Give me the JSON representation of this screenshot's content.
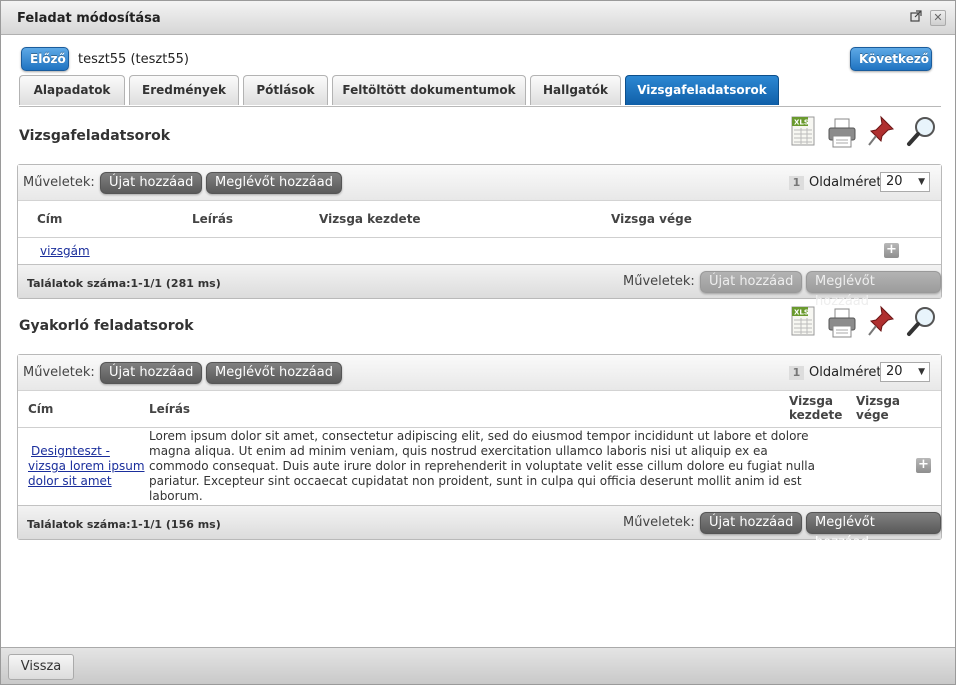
{
  "window": {
    "title": "Feladat módosítása"
  },
  "nav": {
    "prev_label": "Előző",
    "next_label": "Következő",
    "record_name": "teszt55 (teszt55)"
  },
  "tabs": [
    {
      "label": "Alapadatok"
    },
    {
      "label": "Eredmények"
    },
    {
      "label": "Pótlások"
    },
    {
      "label": "Feltöltött dokumentumok"
    },
    {
      "label": "Hallgatók"
    },
    {
      "label": "Vizsgafeladatsorok"
    }
  ],
  "toolbar_icons": [
    "xls-export-icon",
    "print-icon",
    "pin-icon",
    "search-icon"
  ],
  "xls_icon_text": "XLS",
  "section1": {
    "title": "Vizsgafeladatsorok",
    "ops_label": "Műveletek:",
    "add_new": "Újat hozzáad",
    "add_existing": "Meglévőt hozzáad",
    "page_number": "1",
    "page_size_label": "Oldalméret",
    "page_size": "20",
    "columns": {
      "title": "Cím",
      "description": "Leírás",
      "start": "Vizsga kezdete",
      "end": "Vizsga vége"
    },
    "rows": [
      {
        "title": "vizsgám"
      }
    ],
    "result_count": "Találatok száma:1-1/1 (281 ms)"
  },
  "section2": {
    "title": "Gyakorló feladatsorok",
    "ops_label": "Műveletek:",
    "add_new": "Újat hozzáad",
    "add_existing": "Meglévőt hozzáad",
    "page_number": "1",
    "page_size_label": "Oldalméret",
    "page_size": "20",
    "columns": {
      "title": "Cím",
      "description": "Leírás",
      "start_line1": "Vizsga",
      "start_line2": "kezdete",
      "end_line1": "Vizsga",
      "end_line2": "vége"
    },
    "rows": [
      {
        "title_lines": [
          "Designteszt -",
          "vizsga lorem ipsum",
          "dolor sit amet"
        ],
        "description_lines": [
          "Lorem ipsum dolor sit amet, consectetur adipiscing elit, sed do eiusmod tempor incididunt ut labore et dolore",
          "magna aliqua. Ut enim ad minim veniam, quis nostrud exercitation ullamco laboris nisi ut aliquip ex ea",
          "commodo consequat. Duis aute irure dolor in reprehenderit in voluptate velit esse cillum dolore eu fugiat nulla",
          "pariatur. Excepteur sint occaecat cupidatat non proident, sunt in culpa qui officia deserunt mollit anim id est",
          "laborum."
        ]
      }
    ],
    "result_count": "Találatok száma:1-1/1 (156 ms)"
  },
  "footer": {
    "back_label": "Vissza"
  },
  "colors": {
    "accent_blue": "#1f73c1",
    "link": "#1a2e9c",
    "button_gray": "#6a6a6a"
  }
}
